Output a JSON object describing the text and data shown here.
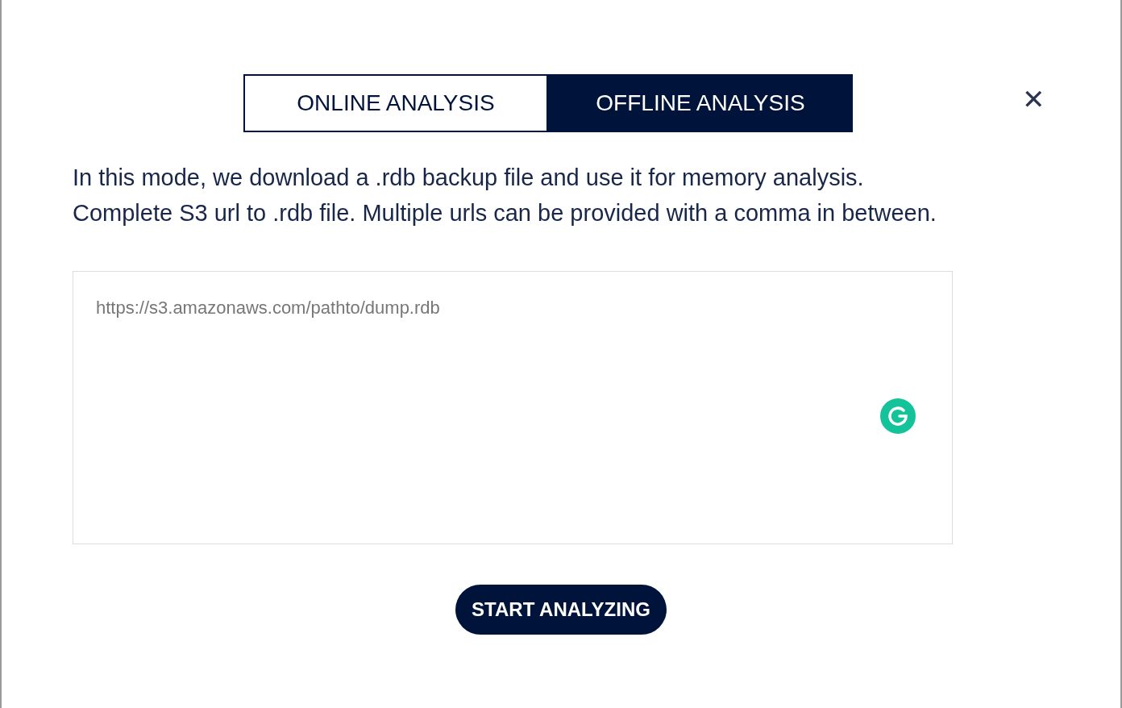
{
  "tabs": [
    {
      "label": "ONLINE ANALYSIS",
      "selected": false
    },
    {
      "label": "OFFLINE ANALYSIS",
      "selected": true
    }
  ],
  "close": {
    "label": "✕"
  },
  "description": [
    "In this mode, we download a .rdb backup file and use it for memory analysis.",
    "Complete S3 url to .rdb file. Multiple urls can be provided with a comma in between."
  ],
  "url_field": {
    "placeholder": "https://s3.amazonaws.com/pathto/dump.rdb"
  },
  "start_button": {
    "label": "START ANALYZING"
  }
}
